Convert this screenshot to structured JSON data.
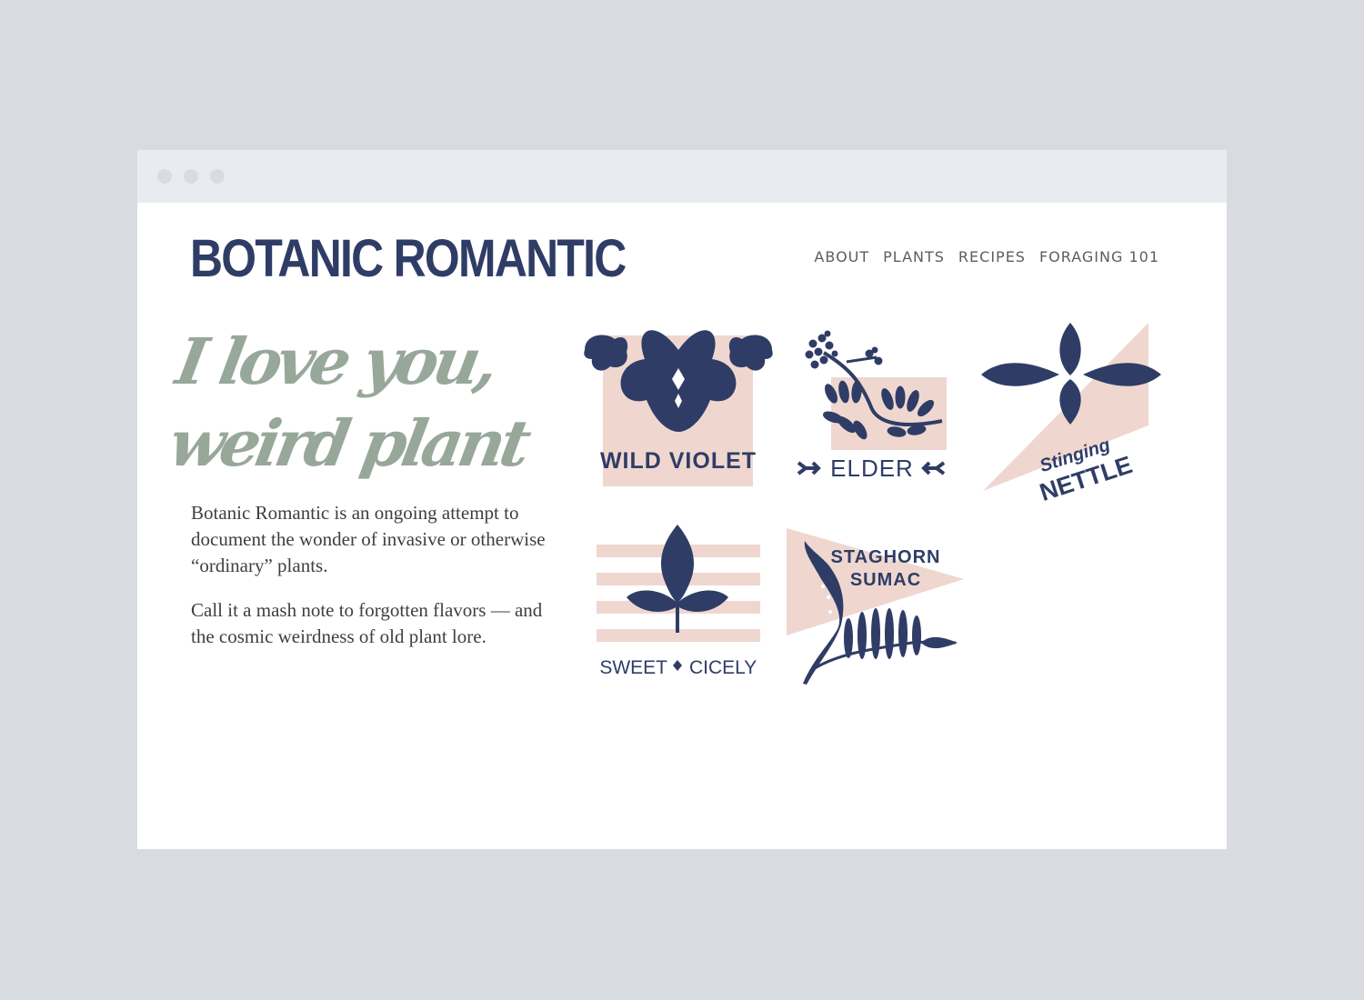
{
  "window": {
    "dots": [
      "window-dot-close",
      "window-dot-minimize",
      "window-dot-zoom"
    ]
  },
  "brand": "BOTANIC ROMANTIC",
  "nav": {
    "items": [
      {
        "label": "ABOUT"
      },
      {
        "label": "PLANTS"
      },
      {
        "label": "RECIPES"
      },
      {
        "label": "FORAGING 101"
      }
    ]
  },
  "hero": {
    "line1": "I love you,",
    "line2": "weird plant"
  },
  "intro": {
    "p1": "Botanic Romantic is an ongoing attempt to document the wonder of invasive or otherwise “ordinary” plants.",
    "p2": "Call it a mash note to forgotten flavors — and the cosmic weirdness of old plant lore."
  },
  "plants": {
    "wild_violet": "WILD VIOLET",
    "elder": "ELDER",
    "stinging": "Stinging",
    "nettle": "NETTLE",
    "sweet": "SWEET",
    "cicely": "CICELY",
    "staghorn": "STAGHORN",
    "sumac": "SUMAC"
  },
  "colors": {
    "navy": "#2f3d66",
    "pink": "#efd7d0",
    "sage": "#97a89a",
    "page_bg": "#d8dbe0",
    "chrome": "#e8ecf0"
  },
  "icons": [
    "violet-icon",
    "elder-icon",
    "nettle-icon",
    "sweet-cicely-icon",
    "staghorn-sumac-icon"
  ]
}
